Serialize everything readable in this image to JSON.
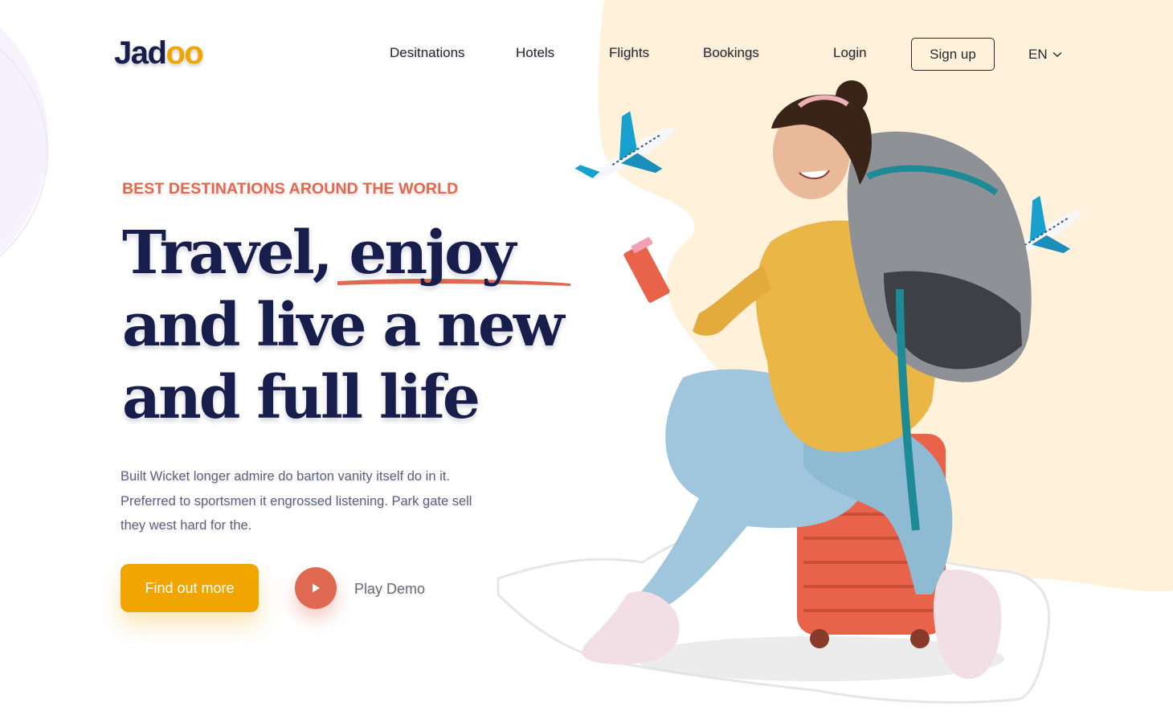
{
  "brand": {
    "name_main": "Jad",
    "name_accent": "oo"
  },
  "nav": {
    "links": [
      "Desitnations",
      "Hotels",
      "Flights",
      "Bookings",
      "Login"
    ],
    "signup_label": "Sign up",
    "language": "EN"
  },
  "hero": {
    "eyebrow": "BEST DESTINATIONS AROUND THE WORLD",
    "headline": {
      "line1_start": "Travel,",
      "line1_emphasis": "enjoy",
      "line2": "and live a new",
      "line3": "and full life"
    },
    "description": "Built Wicket longer admire do barton vanity itself do in it. Preferred to sportsmen it engrossed listening. Park gate sell they west hard for the.",
    "cta_label": "Find out more",
    "play_label": "Play Demo"
  },
  "colors": {
    "accent_orange": "#df6951",
    "cta_yellow": "#f1a501",
    "headline_navy": "#181e4b",
    "body_gray": "#5e6282",
    "peach_bg": "#fff1da"
  },
  "icons": [
    "chevron-down-icon",
    "play-icon",
    "airplane-icon"
  ]
}
